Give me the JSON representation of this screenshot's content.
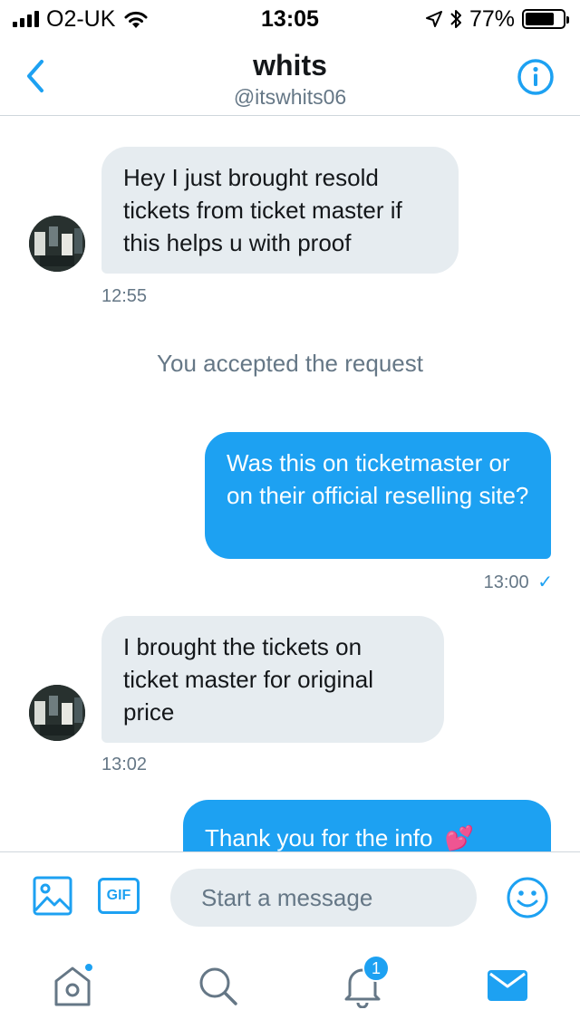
{
  "status_bar": {
    "carrier": "O2-UK",
    "time": "13:05",
    "battery_percent": "77%",
    "battery_level": 0.77,
    "icons": [
      "signal-icon",
      "wifi-icon",
      "location-icon",
      "bluetooth-icon",
      "battery-icon"
    ]
  },
  "header": {
    "title": "whits",
    "handle": "@itswhits06",
    "icons": [
      "back-chevron-icon",
      "info-icon"
    ]
  },
  "conversation": {
    "messages": [
      {
        "direction": "in",
        "text": "Hey I just brought resold tickets from ticket master if this helps u with proof",
        "time": "12:55"
      },
      {
        "direction": "system",
        "text": "You accepted the request"
      },
      {
        "direction": "out",
        "text": "Was this on ticketmaster or on their official reselling site?",
        "time": "13:00",
        "status": "✓"
      },
      {
        "direction": "in",
        "text": "I brought the tickets on ticket master for original price",
        "time": "13:02"
      },
      {
        "direction": "out",
        "text": "Thank you for the info",
        "emoji": "💕"
      }
    ]
  },
  "composer": {
    "gif_label": "GIF",
    "placeholder": "Start a message",
    "icons": [
      "image-icon",
      "gif-icon",
      "emoji-icon"
    ]
  },
  "tabbar": {
    "notifications_badge": "1",
    "accent": "#1da1f2",
    "icons": [
      "home-icon",
      "search-icon",
      "bell-icon",
      "mail-icon"
    ]
  },
  "colors": {
    "accent": "#1da1f2",
    "bubble_in": "#e6ecf0",
    "secondary_text": "#657786"
  }
}
